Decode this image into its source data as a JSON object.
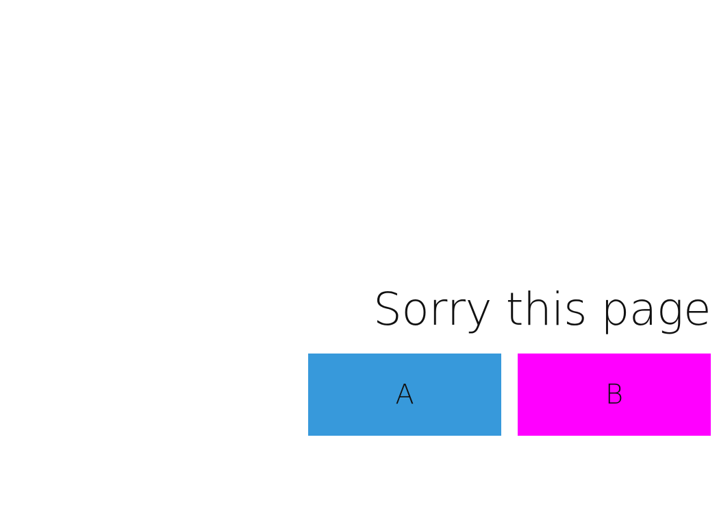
{
  "message": {
    "text": "Sorry this page c"
  },
  "buttons": [
    {
      "label": "A",
      "color": "#3799db"
    },
    {
      "label": "B",
      "color": "#ff00ff"
    }
  ]
}
